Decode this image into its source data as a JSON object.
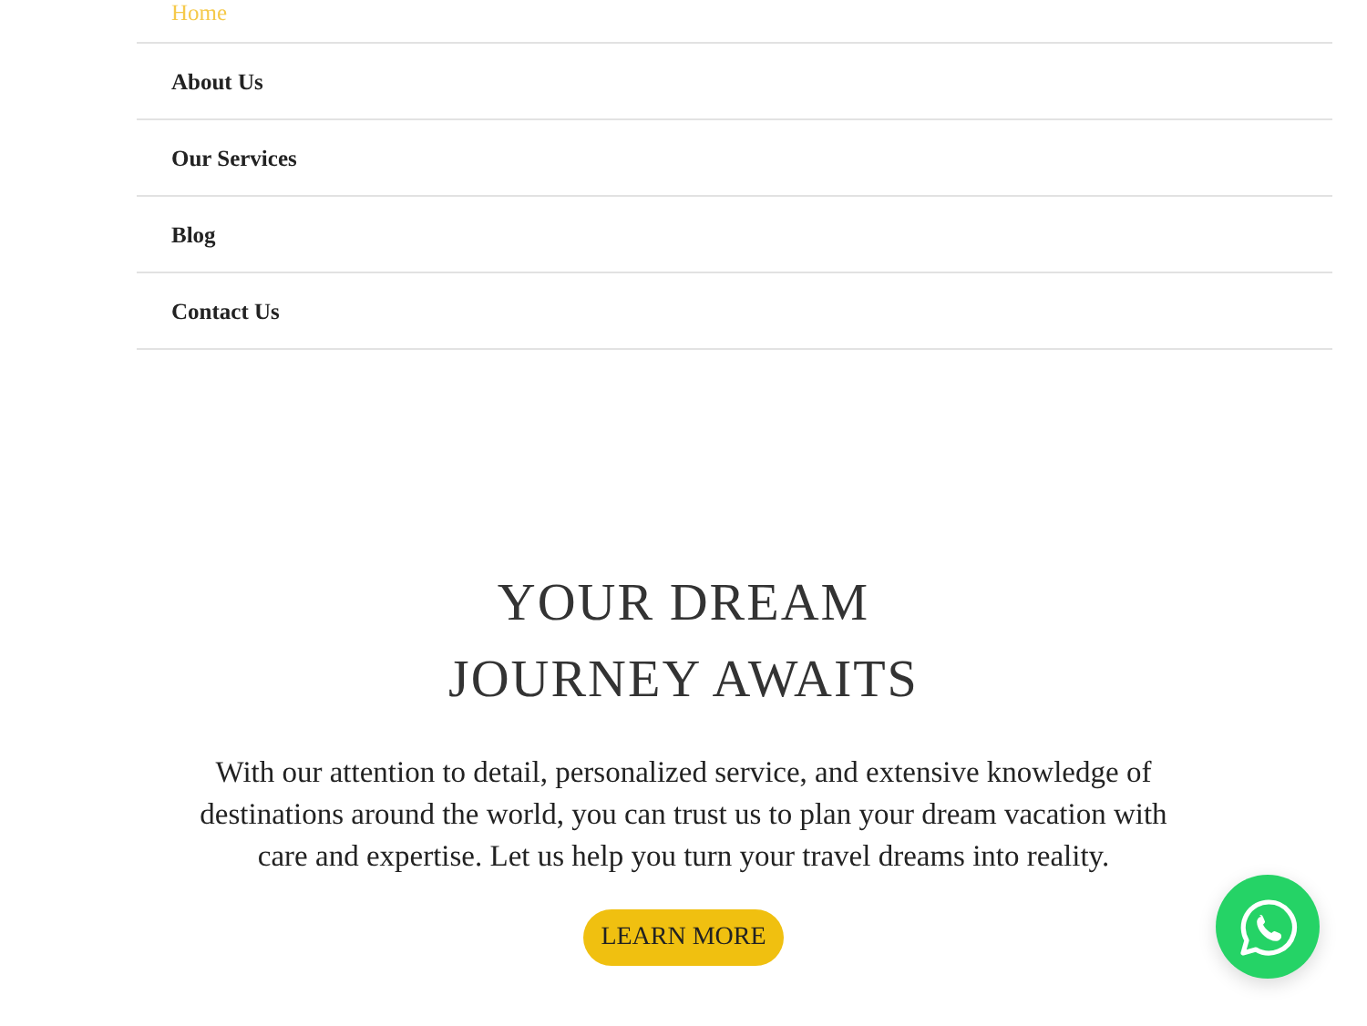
{
  "menu": [
    {
      "label": "Home",
      "selected": true
    },
    {
      "label": "About Us",
      "selected": false
    },
    {
      "label": "Our Services",
      "selected": false
    },
    {
      "label": "Blog",
      "selected": false
    },
    {
      "label": "Contact Us",
      "selected": false
    }
  ],
  "hero": {
    "heading": [
      "YOUR DREAM",
      "JOURNEY AWAITS"
    ],
    "text": "With our attention to detail, personalized service, and extensive knowledge of destinations around the world, you can trust us to plan your dream vacation with care and expertise. Let us help you turn your travel dreams into reality.",
    "button": "LEARN MORE"
  }
}
